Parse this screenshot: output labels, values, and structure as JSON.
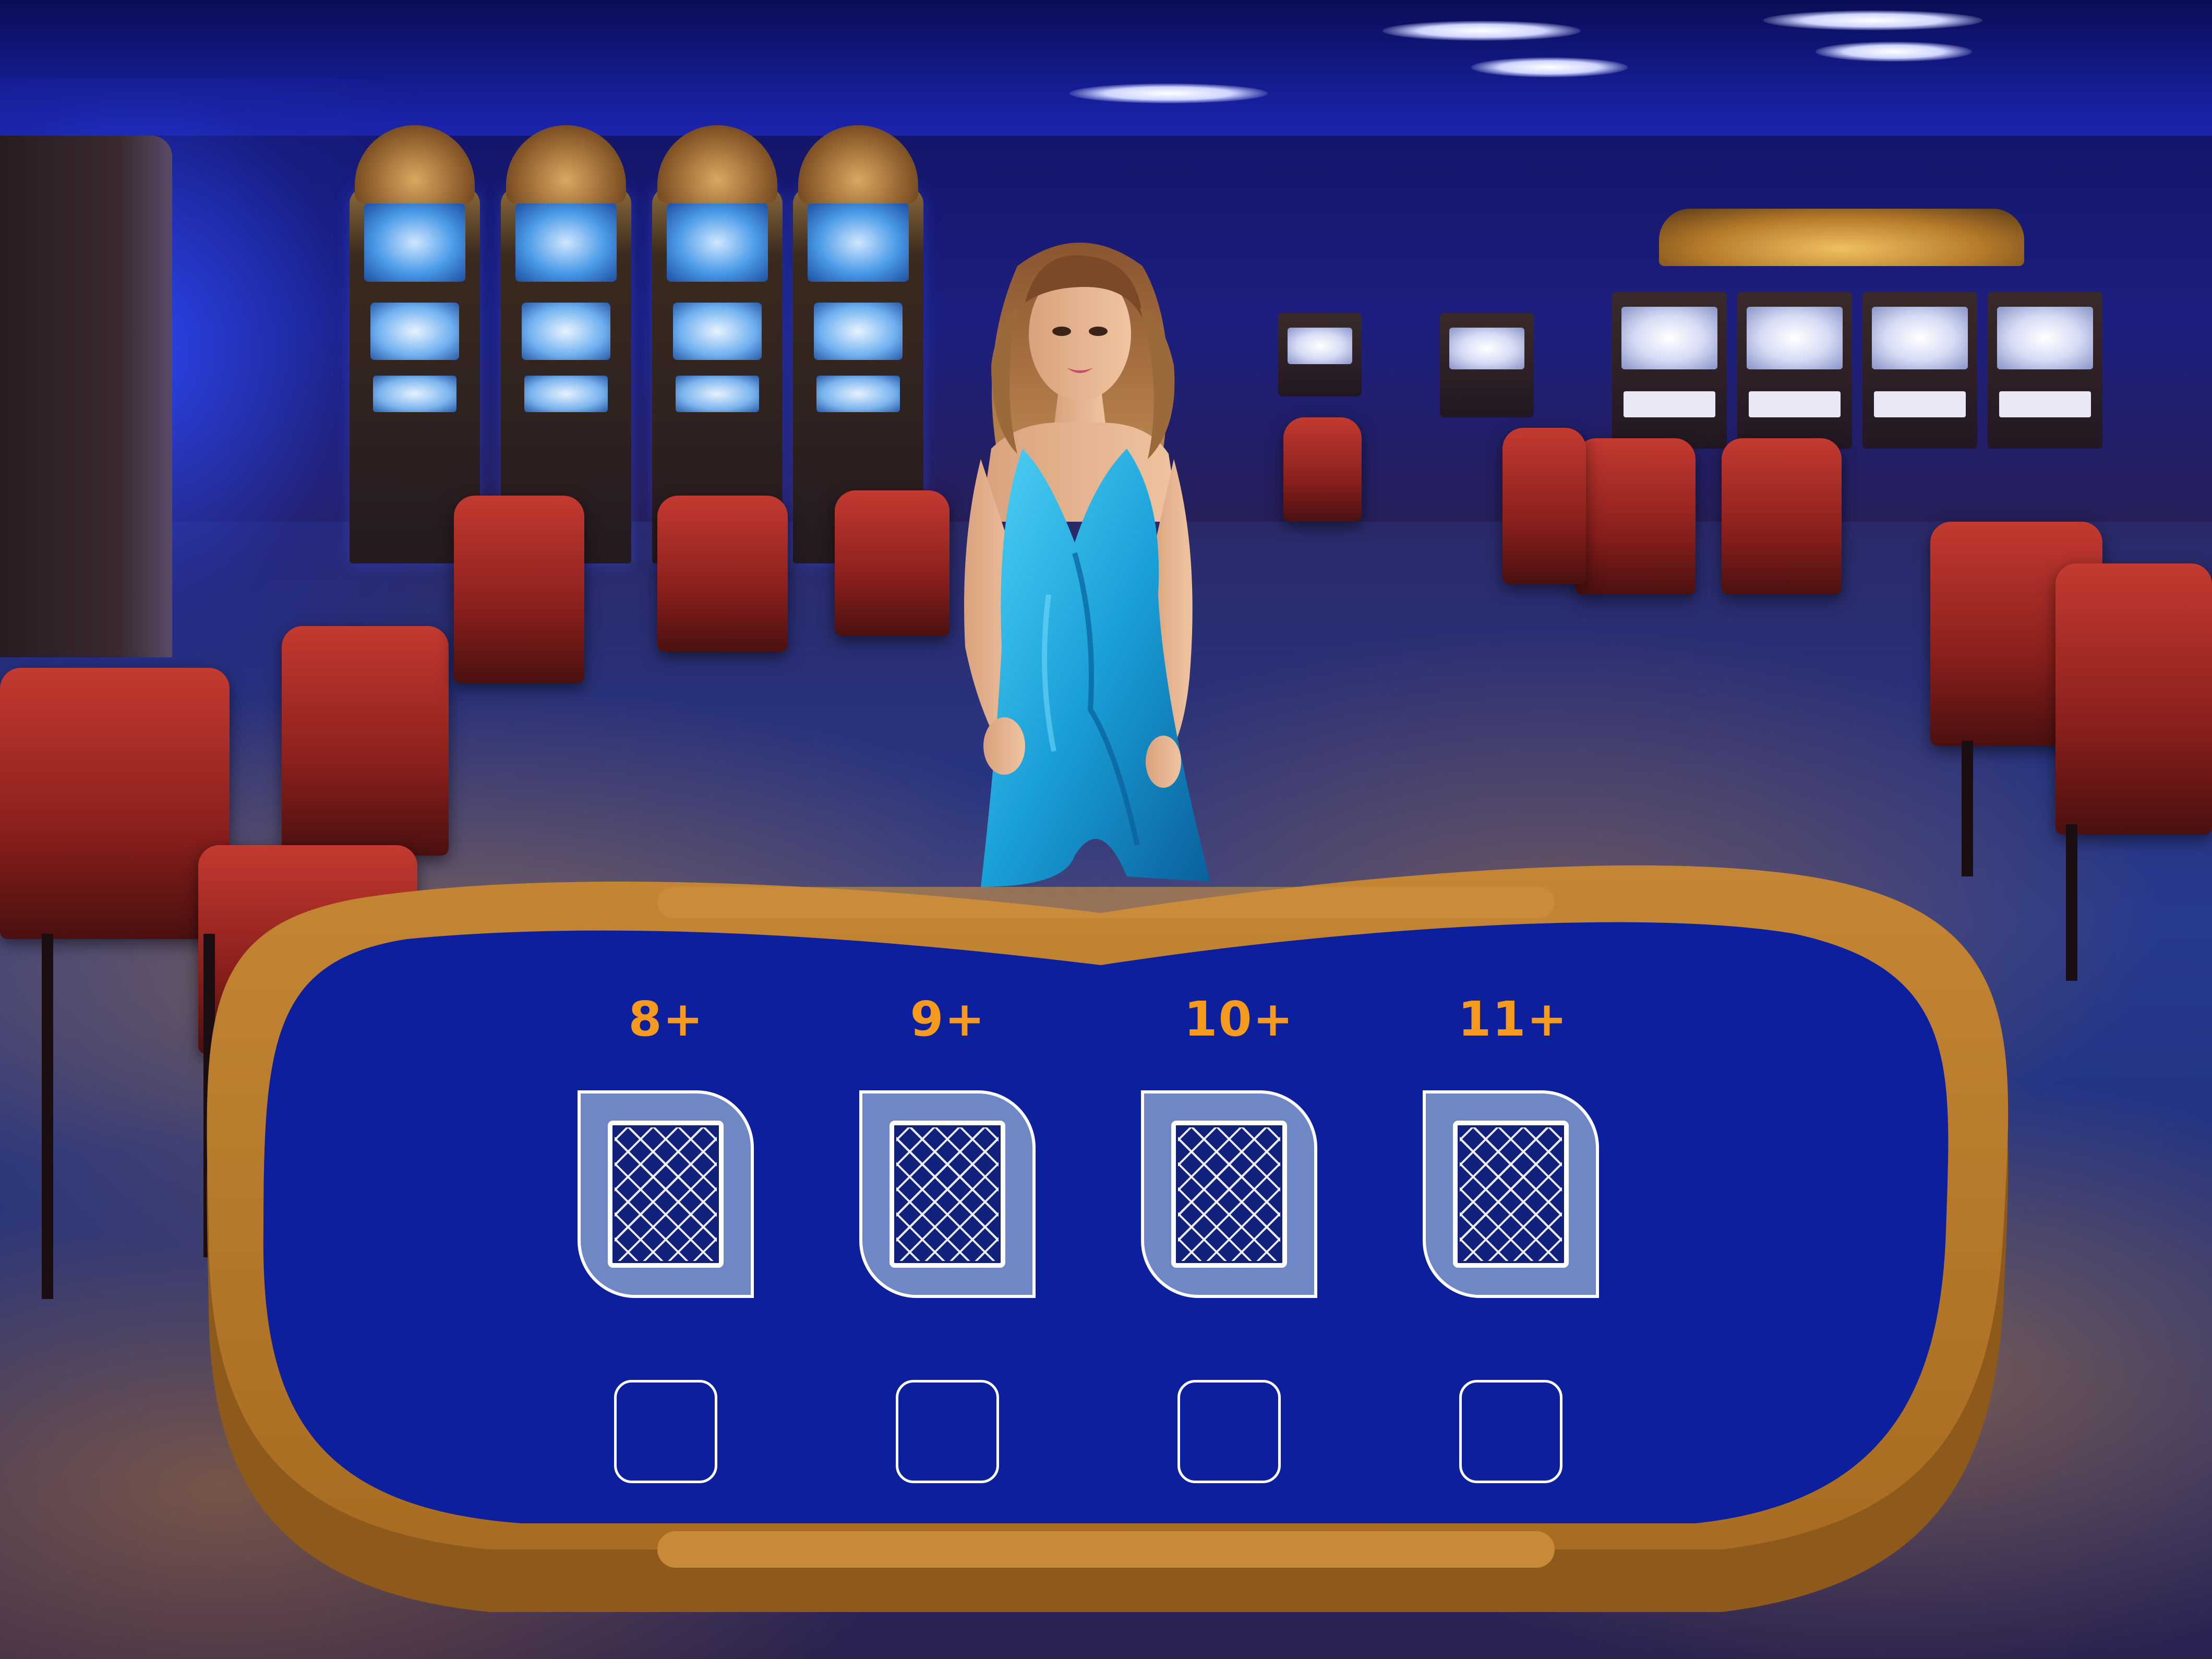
{
  "game": {
    "title": "",
    "bet_options": [
      {
        "label": "8+"
      },
      {
        "label": "9+"
      },
      {
        "label": "10+"
      },
      {
        "label": "11+"
      }
    ]
  },
  "colors": {
    "felt": "#0c1f9c",
    "rail": "#b87a2c",
    "rail_dark": "#8e5a1c",
    "label": "#f59a1c",
    "card_frame": "#6f87c4",
    "card_back": "#11207a",
    "outline": "#ffffff"
  },
  "icons": {
    "card": "card-back-icon"
  }
}
